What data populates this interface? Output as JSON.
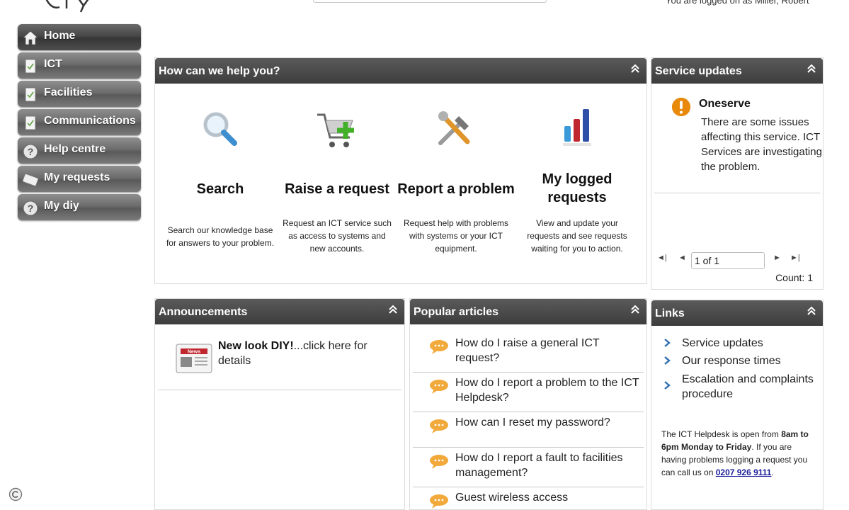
{
  "header": {
    "logged_on_text": "You are logged on as Miller, Robert"
  },
  "nav": {
    "items": [
      {
        "label": "Home",
        "icon": "house-icon"
      },
      {
        "label": "ICT",
        "icon": "checklist-icon"
      },
      {
        "label": "Facilities",
        "icon": "checklist-icon"
      },
      {
        "label": "Communications",
        "icon": "checklist-icon"
      },
      {
        "label": "Help centre",
        "icon": "question-icon"
      },
      {
        "label": "My requests",
        "icon": "ticket-icon"
      },
      {
        "label": "My diy",
        "icon": "question-icon"
      }
    ]
  },
  "help": {
    "title": "How can we help you?",
    "options": [
      {
        "title": "Search",
        "desc": "Search our knowledge base for answers to your problem.",
        "icon": "magnifier-icon"
      },
      {
        "title": "Raise a request",
        "desc": "Request an ICT service such as access to systems and new accounts.",
        "icon": "cart-add-icon"
      },
      {
        "title": "Report a problem",
        "desc": "Request help with problems with systems or your ICT equipment.",
        "icon": "tools-icon"
      },
      {
        "title": "My logged requests",
        "desc": "View and update your requests and see requests waiting for you to action.",
        "icon": "bar-chart-icon"
      }
    ]
  },
  "service_updates": {
    "title": "Service updates",
    "item_title": "Oneserve",
    "item_text": "There are some issues affecting this service. ICT Services are investigating the problem.",
    "pager_value": "1 of 1",
    "count": "Count: 1"
  },
  "announcements": {
    "title": "Announcements",
    "item_bold": "New look DIY!",
    "item_rest": "...click here for details",
    "icon_text": "News"
  },
  "popular": {
    "title": "Popular articles",
    "items": [
      "How do I raise a general ICT request?",
      "How do I report a problem to the ICT Helpdesk?",
      "How can I reset my password?",
      "How do I report a fault to facilities management?",
      "Guest wireless access"
    ]
  },
  "links": {
    "title": "Links",
    "items": [
      "Service updates",
      "Our response times",
      "Escalation and complaints procedure"
    ],
    "helpdesk_pre": "The ICT Helpdesk is open from ",
    "helpdesk_hours": "8am to 6pm Monday to Friday",
    "helpdesk_mid": ". If you are having problems logging a request you can call us on ",
    "helpdesk_phone": "0207 926 9111",
    "helpdesk_end": "."
  },
  "colors": {
    "header_bg": "#3d3d3d",
    "nav_bg": "#6c6c6c",
    "warning": "#e8890c",
    "link_chevron": "#2f6fb0",
    "phone_link": "#1a1a9a"
  }
}
